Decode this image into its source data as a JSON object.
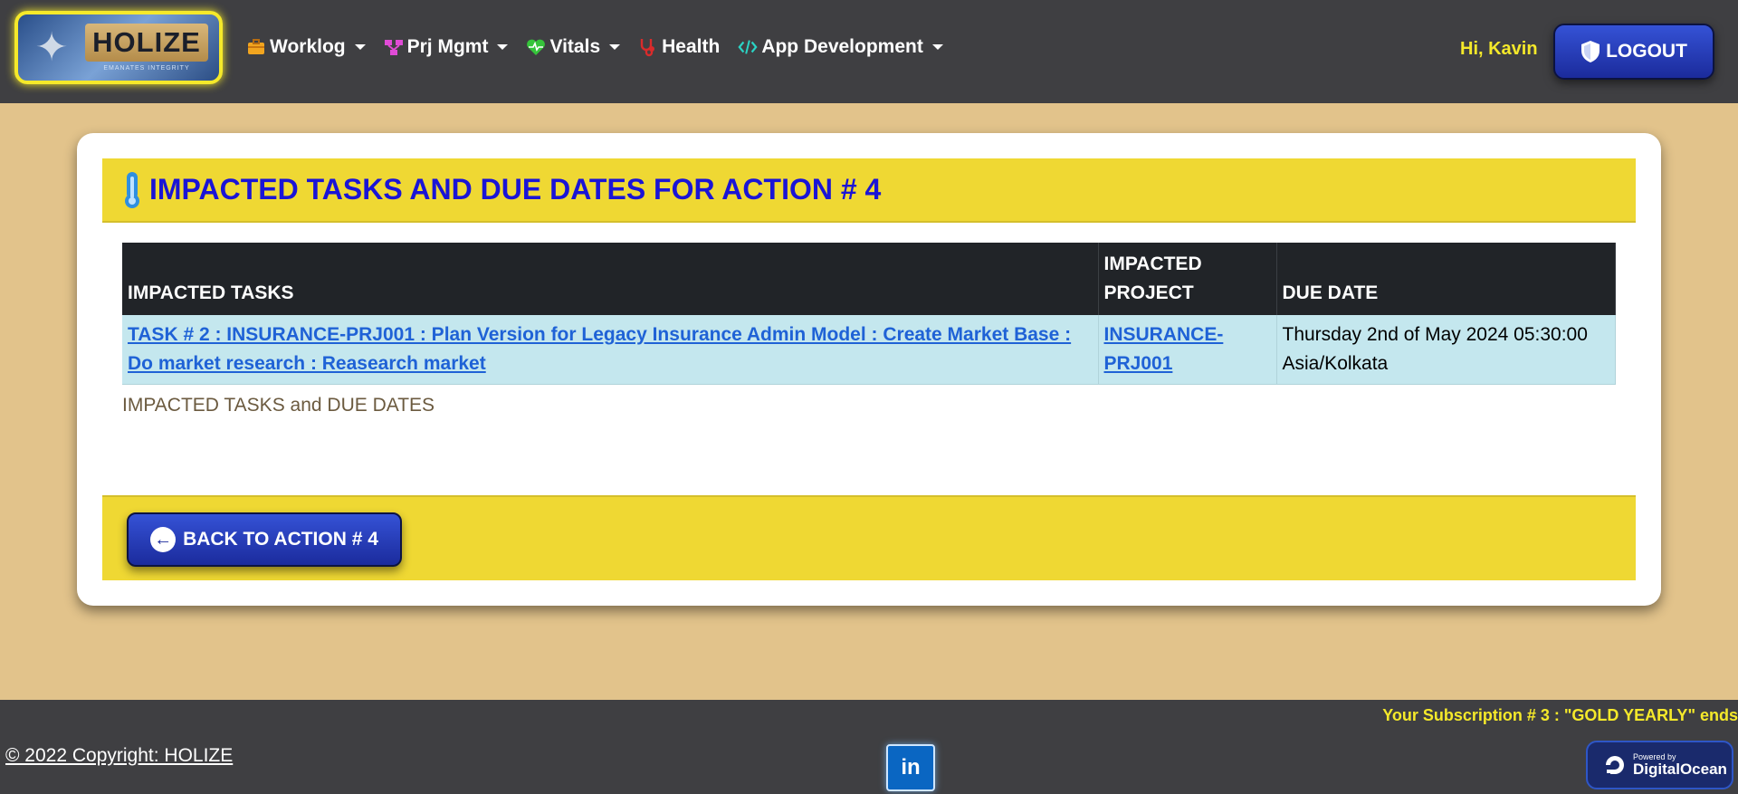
{
  "brand": {
    "name": "HOLIZE",
    "tagline": "EMANATES INTEGRITY"
  },
  "nav": {
    "items": [
      {
        "label": "Worklog",
        "icon": "briefcase-icon",
        "dropdown": true
      },
      {
        "label": "Prj Mgmt",
        "icon": "project-tree-icon",
        "dropdown": true
      },
      {
        "label": "Vitals",
        "icon": "heart-pulse-icon",
        "dropdown": true
      },
      {
        "label": "Health",
        "icon": "stethoscope-icon",
        "dropdown": false
      },
      {
        "label": "App Development",
        "icon": "code-icon",
        "dropdown": true
      }
    ],
    "greeting": "Hi, Kavin",
    "logout_label": "LOGOUT"
  },
  "page": {
    "title": "IMPACTED TASKS AND DUE DATES FOR ACTION # 4",
    "table": {
      "headers": [
        "IMPACTED TASKS",
        "IMPACTED PROJECT",
        "DUE DATE"
      ],
      "rows": [
        {
          "task": "TASK # 2 : INSURANCE-PRJ001 : Plan Version for Legacy Insurance Admin Model : Create Market Base : Do market research : Reasearch market",
          "project": "INSURANCE-PRJ001",
          "due_date": "Thursday 2nd of May 2024 05:30:00 Asia/Kolkata"
        }
      ]
    },
    "caption": "IMPACTED TASKS and DUE DATES",
    "back_button_label": "BACK TO ACTION # 4"
  },
  "footer": {
    "subscription": "Your Subscription # 3 : \"GOLD YEARLY\" ends",
    "copyright": "© 2022 Copyright: HOLIZE",
    "linkedin_label": "in",
    "digitalocean_small": "Powered by",
    "digitalocean_big": "DigitalOcean"
  },
  "colors": {
    "navbar": "#3f3f42",
    "page_bg": "#e2c38b",
    "accent_yellow": "#efd833",
    "title_blue": "#1a14d6",
    "link_blue": "#1f62d6",
    "button_blue": "#2a41c0"
  }
}
